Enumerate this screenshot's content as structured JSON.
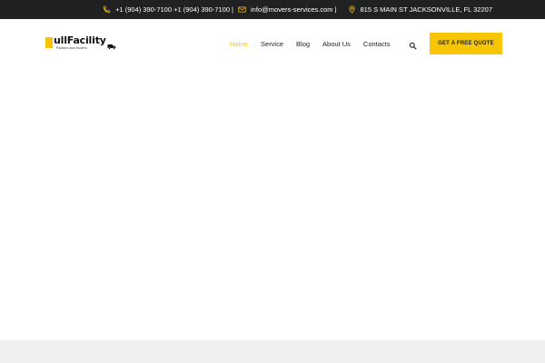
{
  "topbar": {
    "phone_icon": "phone-icon",
    "phones": "+1 (904) 390-7100 +1 (904) 390-7100",
    "separator": "|",
    "email_icon": "envelope-icon",
    "email": "info@movers-services.com",
    "location_icon": "map-pin-icon",
    "address": "815 S MAIN ST JACKSONVILLE, FL 32207"
  },
  "brand": {
    "name": "ullFacility",
    "tagline": "Packers and Movers",
    "accent_color": "#f7c600",
    "topbar_color": "#1f2123"
  },
  "nav": {
    "items": [
      {
        "label": "Home",
        "active": true
      },
      {
        "label": "Service",
        "active": false
      },
      {
        "label": "Blog",
        "active": false
      },
      {
        "label": "About Us",
        "active": false
      },
      {
        "label": "Contacts",
        "active": false
      }
    ],
    "search_icon": "search-icon",
    "cta_label": "GET A FREE QUOTE"
  }
}
